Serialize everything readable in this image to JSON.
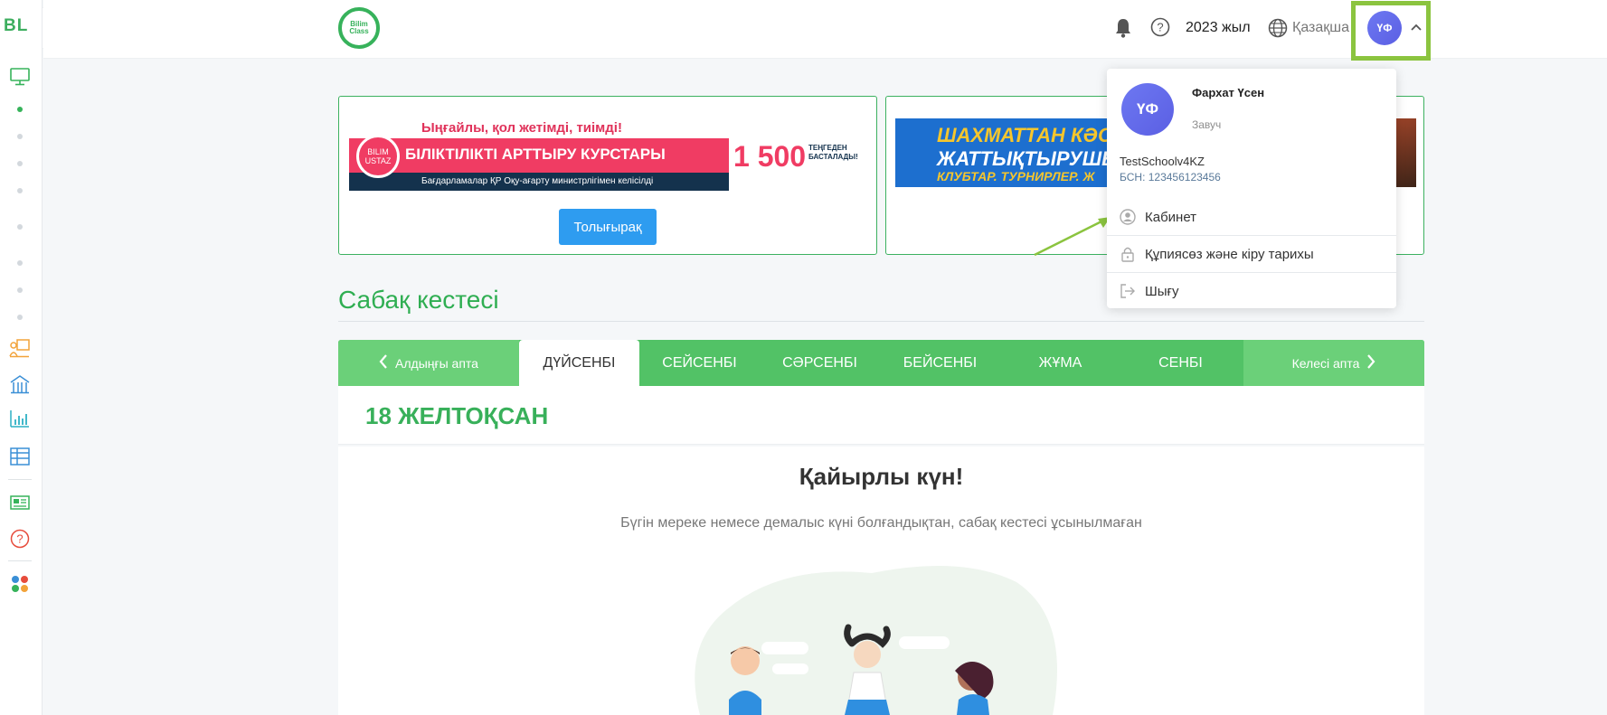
{
  "sidebar": {
    "logo": "BL",
    "toggle_icon": "chevron-right-icon",
    "icons": [
      "monitor-icon",
      "teacher-board-icon",
      "school-building-icon",
      "bar-chart-icon",
      "table-icon",
      "news-icon",
      "help-circle-icon",
      "apps-grid-icon"
    ],
    "colors": {
      "green": "#36b35a",
      "orange": "#f2a33a",
      "blue": "#3a8fd6",
      "teal": "#2cb0c4",
      "red": "#e74c3c"
    }
  },
  "header": {
    "brand": "Bilim Class",
    "year": "2023 жыл",
    "language": "Қазақша",
    "avatar_initials": "ҮФ",
    "icons": [
      "bell-icon",
      "help-circle-icon",
      "globe-icon",
      "chevron-up-icon"
    ]
  },
  "banners": [
    {
      "top_text": "Ыңғайлы, қол жетімді, тиімді!",
      "logo_text": "BILIM USTAZ",
      "main_text": "БІЛІКТІЛІКТІ АРТТЫРУ КУРСТАРЫ",
      "price": "1 500",
      "price_sub": "ТЕҢГЕДЕН БАСТАЛАДЫ!",
      "bottom_text": "Бағдарламалар ҚР Оқу-ағарту министрлігімен келісілді",
      "button": "Толығырақ"
    },
    {
      "line1": "ШАХМАТТАН КӘС",
      "line2": "ЖАТТЫҚТЫРУШЫ",
      "line3": "КЛУБТАР. ТУРНИРЛЕР. Ж"
    }
  ],
  "schedule": {
    "title": "Сабақ кестесі",
    "prev_week": "Алдыңғы апта",
    "next_week": "Келесі апта",
    "days": [
      "ДҮЙСЕНБІ",
      "СЕЙСЕНБІ",
      "СӘРСЕНБІ",
      "БЕЙСЕНБІ",
      "ЖҰМА",
      "СЕНБІ"
    ],
    "active_day": "ДҮЙСЕНБІ",
    "date": "18 ЖЕЛТОҚСАН",
    "greeting": "Қайырлы күн!",
    "message": "Бүгін мереке немесе демалыс күні болғандықтан, сабақ кестесі ұсынылмаған"
  },
  "user_menu": {
    "initials": "ҮФ",
    "name": "Фархат Үсен",
    "role": "Завуч",
    "school": "TestSchoolv4KZ",
    "bin": "БСН: 123456123456",
    "items": [
      {
        "label": "Кабинет",
        "icon": "user-circle-icon"
      },
      {
        "label": "Құпиясөз және кіру тарихы",
        "icon": "lock-icon"
      },
      {
        "label": "Шығу",
        "icon": "logout-icon"
      }
    ]
  },
  "colors": {
    "accent_green": "#52c266",
    "avatar": "#6d78f2",
    "highlight_box": "#8bc43f",
    "button_blue": "#2e9cf0"
  }
}
